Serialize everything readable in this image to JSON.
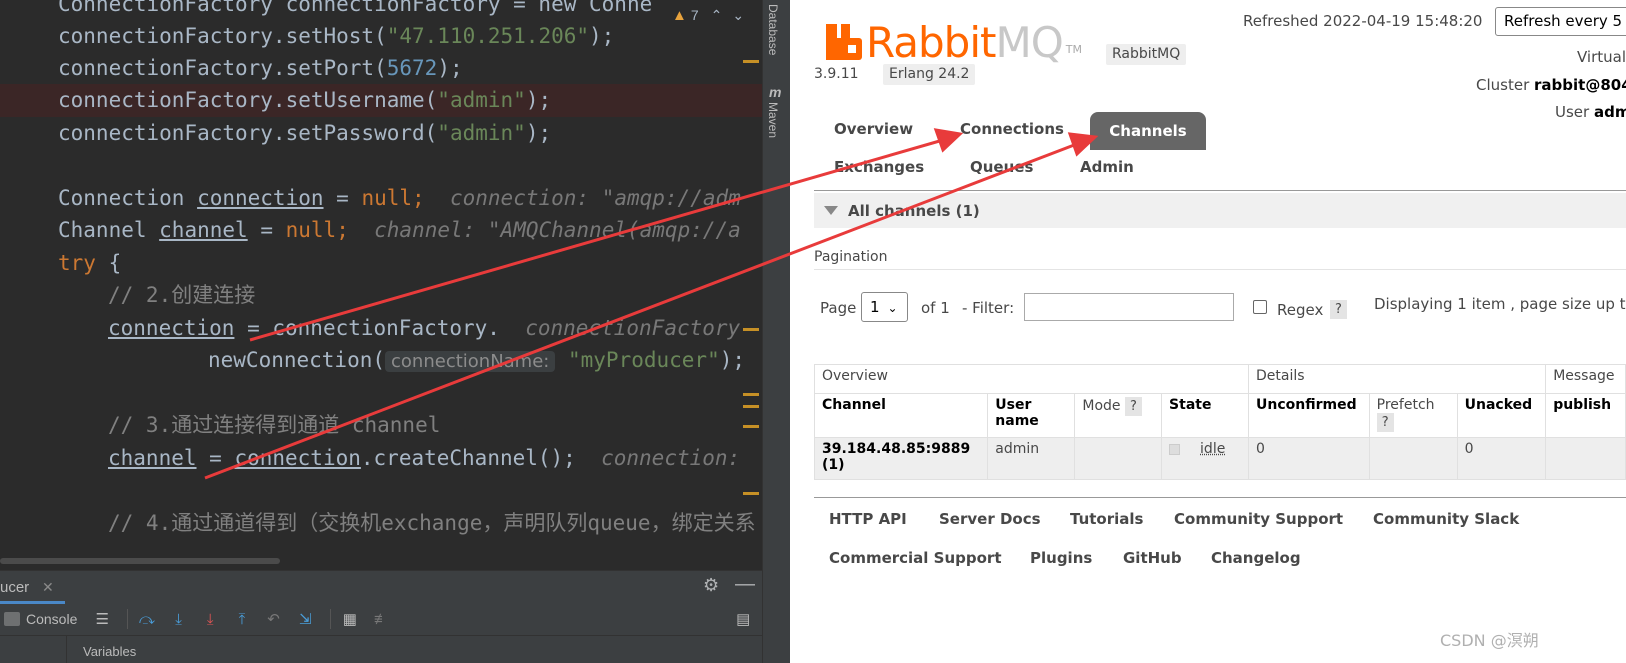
{
  "ide": {
    "code_lines": [
      {
        "parts": [
          "ConnectionFactory connectionFactory = new Conne"
        ]
      },
      {
        "parts": [
          "connectionFactory.setHost(",
          "\"47.110.251.206\"",
          ");"
        ]
      },
      {
        "parts": [
          "connectionFactory.setPort(",
          "5672",
          ");"
        ]
      },
      {
        "parts": [
          "connectionFactory.setUsername(",
          "\"admin\"",
          ");"
        ]
      },
      {
        "parts": [
          "connectionFactory.setPassword(",
          "\"admin\"",
          ");"
        ]
      },
      {
        "parts": [
          "Connection ",
          "connection",
          " = ",
          "null",
          ";",
          "  connection: \"amqp://adm"
        ]
      },
      {
        "parts": [
          "Channel ",
          "channel",
          " = ",
          "null",
          ";",
          "  channel: \"AMQChannel(amqp://a"
        ]
      },
      {
        "parts": [
          "try",
          " {"
        ]
      },
      {
        "parts": [
          "// 2.创建连接"
        ]
      },
      {
        "parts": [
          "connection",
          " = connectionFactory.",
          "  connectionFactory"
        ]
      },
      {
        "parts": [
          "newConnection(",
          "connectionName:",
          " \"myProducer\"",
          ");"
        ]
      },
      {
        "parts": [
          "// 3.通过连接得到通道 channel"
        ]
      },
      {
        "parts": [
          "channel",
          " = ",
          "connection",
          ".createChannel();",
          "  connection:"
        ]
      },
      {
        "parts": [
          "// 4.通过通道得到（交换机exchange，声明队列queue，绑定关系"
        ]
      }
    ],
    "warning_count": "7",
    "side_tabs": {
      "database": "Database",
      "maven": "Maven"
    },
    "debug": {
      "title": "ucer",
      "console_label": "Console",
      "variables_label": "Variables"
    }
  },
  "rmq": {
    "logo": {
      "rabbit": "Rabbit",
      "mq": "MQ",
      "tm": "TM"
    },
    "product_badge": "RabbitMQ",
    "version": "3.9.11",
    "erlang": "Erlang 24.2",
    "refreshed": "Refreshed 2022-04-19 15:48:20",
    "refresh_select": "Refresh every 5",
    "virtual_label": "Virtual",
    "cluster_label": "Cluster",
    "cluster_value": "rabbit@804",
    "user_label": "User",
    "user_value": "adm",
    "nav": {
      "overview": "Overview",
      "connections": "Connections",
      "channels": "Channels",
      "exchanges": "Exchanges",
      "queues": "Queues",
      "admin": "Admin"
    },
    "section_title": "All channels (1)",
    "pagination": {
      "label": "Pagination",
      "page_label": "Page",
      "page_value": "1",
      "of_text": "of 1",
      "filter_label": "- Filter:",
      "regex_label": "Regex",
      "help": "?",
      "display_text": "Displaying 1 item , page size up t"
    },
    "table": {
      "groups": {
        "overview": "Overview",
        "details": "Details",
        "message": "Message"
      },
      "headers": {
        "channel": "Channel",
        "user_name": "User name",
        "mode": "Mode",
        "state": "State",
        "unconfirmed": "Unconfirmed",
        "prefetch": "Prefetch",
        "unacked": "Unacked",
        "publish": "publish"
      },
      "row": {
        "channel": "39.184.48.85:9889 (1)",
        "user": "admin",
        "mode": "",
        "state": "idle",
        "unconfirmed": "0",
        "prefetch": "",
        "unacked": "0",
        "publish": ""
      }
    },
    "footer_links": [
      "HTTP API",
      "Server Docs",
      "Tutorials",
      "Community Support",
      "Community Slack",
      "Commercial Support",
      "Plugins",
      "GitHub",
      "Changelog"
    ]
  },
  "watermark": "CSDN @溟朔",
  "colors": {
    "rabbit_orange": "#ff6600",
    "annotation_red": "#e83b3b",
    "nav_active": "#666666"
  }
}
